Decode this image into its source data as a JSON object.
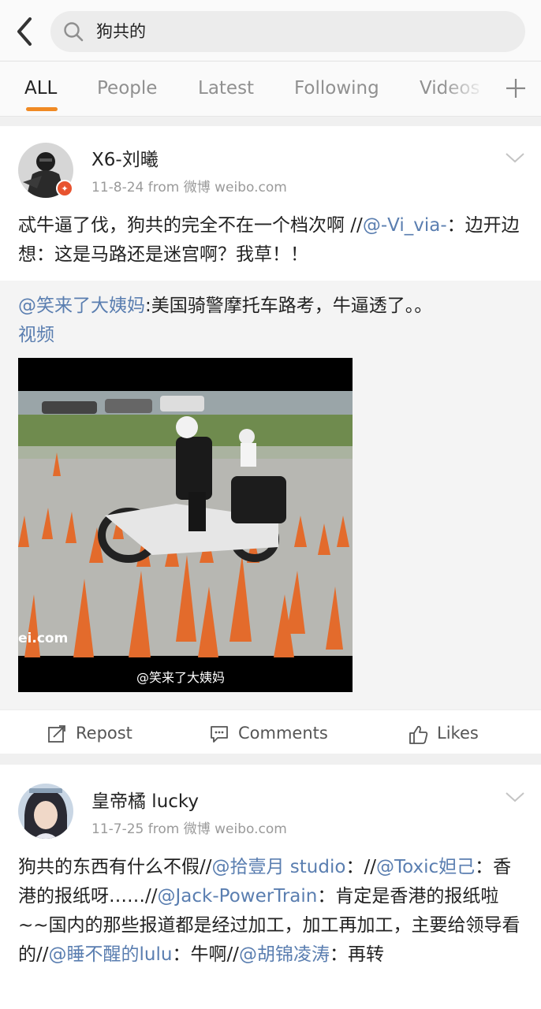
{
  "search": {
    "query": "狗共的"
  },
  "tabs": [
    {
      "label": "ALL",
      "active": true
    },
    {
      "label": "People",
      "active": false
    },
    {
      "label": "Latest",
      "active": false
    },
    {
      "label": "Following",
      "active": false
    },
    {
      "label": "Videos",
      "active": false
    }
  ],
  "posts": [
    {
      "username": "X6-刘曦",
      "meta": "11-8-24  from 微博 weibo.com",
      "verified": true,
      "text": {
        "t1": "忒牛逼了伐，狗共的完全不在一个档次啊 //",
        "m1": "@-Vi_via-",
        "t2": "：边开边想：这是马路还是迷宫啊？我草！！"
      },
      "repost": {
        "mention": "@笑来了大姨妈",
        "text": ":美国骑警摩托车路考，牛逼透了。。",
        "link": "视频",
        "video_watermark": "@笑来了大姨妈",
        "video_corner": "ei.com"
      },
      "actions": {
        "repost": "Repost",
        "comments": "Comments",
        "likes": "Likes"
      }
    },
    {
      "username": "皇帝橘 lucky",
      "meta": "11-7-25  from 微博 weibo.com",
      "text": {
        "t1": "狗共的东西有什么不假//",
        "m1": "@拾壹月 studio",
        "t2": "：//",
        "m2": "@Toxic妲己",
        "t3": "：香港的报纸呀……//",
        "m3": "@Jack-PowerTrain",
        "t4": "：肯定是香港的报纸啦~~国内的那些报道都是经过加工，加工再加工，主要给领导看的//",
        "m4": "@睡不醒的lulu",
        "t5": "：牛啊//",
        "m5": "@胡锦凌涛",
        "t6": "：再转"
      }
    }
  ],
  "colors": {
    "accent": "#f08a24",
    "link": "#5a7eb0",
    "badge": "#e8532f"
  },
  "icons": [
    "back-arrow-icon",
    "search-icon",
    "plus-icon",
    "verified-badge-icon",
    "chevron-down-icon",
    "repost-icon",
    "comment-icon",
    "like-icon"
  ]
}
